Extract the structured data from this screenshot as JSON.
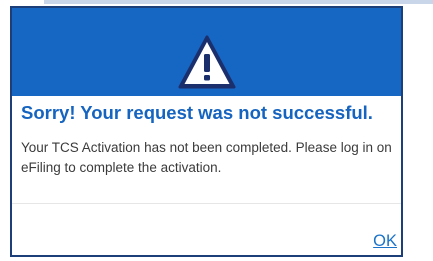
{
  "dialog": {
    "icon": "warning-triangle-icon",
    "title": "Sorry! Your request was not successful.",
    "message": "Your TCS Activation has not been completed. Please log in on eFiling to complete the activation.",
    "ok_label": "OK"
  },
  "colors": {
    "header": "#1666c4",
    "title": "#1564c0",
    "border": "#1c3f7a",
    "icon": "#1a2f6b",
    "link": "#1a73c8"
  }
}
